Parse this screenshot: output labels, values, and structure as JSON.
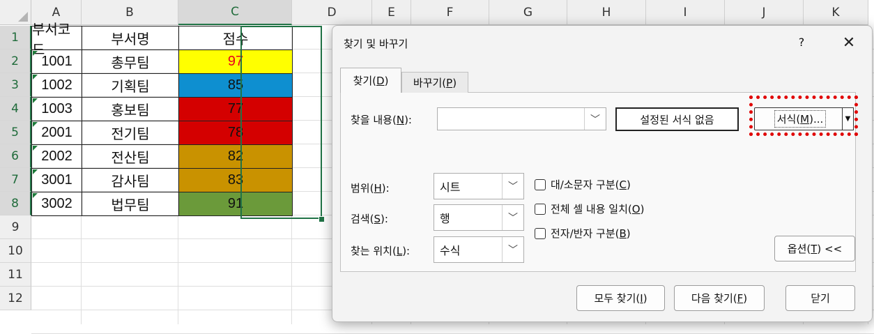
{
  "sheet": {
    "columns": [
      "A",
      "B",
      "C",
      "D",
      "E",
      "F",
      "G",
      "H",
      "I",
      "J",
      "K"
    ],
    "rows": [
      "1",
      "2",
      "3",
      "4",
      "5",
      "6",
      "7",
      "8",
      "9",
      "10",
      "11",
      "12"
    ],
    "headers": {
      "code": "부서코드",
      "name": "부서명",
      "score": "점수"
    },
    "data": [
      {
        "code": "1001",
        "name": "총무팀",
        "score": "97",
        "fill": "#ffff00",
        "font": "#e8001c"
      },
      {
        "code": "1002",
        "name": "기획팀",
        "score": "85",
        "fill": "#0e8fd0",
        "font": "#111111"
      },
      {
        "code": "1003",
        "name": "홍보팀",
        "score": "77",
        "fill": "#d40000",
        "font": "#111111"
      },
      {
        "code": "2001",
        "name": "전기팀",
        "score": "78",
        "fill": "#d40000",
        "font": "#111111"
      },
      {
        "code": "2002",
        "name": "전산팀",
        "score": "82",
        "fill": "#c99200",
        "font": "#111111"
      },
      {
        "code": "3001",
        "name": "감사팀",
        "score": "83",
        "fill": "#c99200",
        "font": "#111111"
      },
      {
        "code": "3002",
        "name": "법무팀",
        "score": "91",
        "fill": "#6b9a3a",
        "font": "#111111"
      }
    ],
    "selected_column": "C",
    "accent": "#217346"
  },
  "dialog": {
    "title": "찾기 및 바꾸기",
    "help": "?",
    "close": "✕",
    "tabs": {
      "find": {
        "text": "찾기(",
        "key": "D",
        "end": ")"
      },
      "replace": {
        "text": "바꾸기(",
        "key": "P",
        "end": ")"
      }
    },
    "find_what": {
      "text": "찾을 내용(",
      "key": "N",
      "end": "):",
      "value": ""
    },
    "format_preview": "설정된 서식 없음",
    "format_button": {
      "text": "서식(",
      "key": "M",
      "end": ")..."
    },
    "within": {
      "text": "범위(",
      "key": "H",
      "end": "):",
      "value": "시트"
    },
    "search": {
      "text": "검색(",
      "key": "S",
      "end": "):",
      "value": "행"
    },
    "look_in": {
      "text": "찾는 위치(",
      "key": "L",
      "end": "):",
      "value": "수식"
    },
    "options": {
      "match_case": {
        "text": "대/소문자 구분(",
        "key": "C",
        "end": ")"
      },
      "entire_cell": {
        "text": "전체 셀 내용 일치(",
        "key": "O",
        "end": ")"
      },
      "byte_width": {
        "text": "전자/반자 구분(",
        "key": "B",
        "end": ")"
      }
    },
    "options_button": {
      "text": "옵션(",
      "key": "T",
      "end": ") <<"
    },
    "find_all": {
      "text": "모두 찾기(",
      "key": "I",
      "end": ")"
    },
    "find_next": {
      "text": "다음 찾기(",
      "key": "F",
      "end": ")"
    },
    "close_button": "닫기",
    "highlight_color": "#e00000"
  }
}
